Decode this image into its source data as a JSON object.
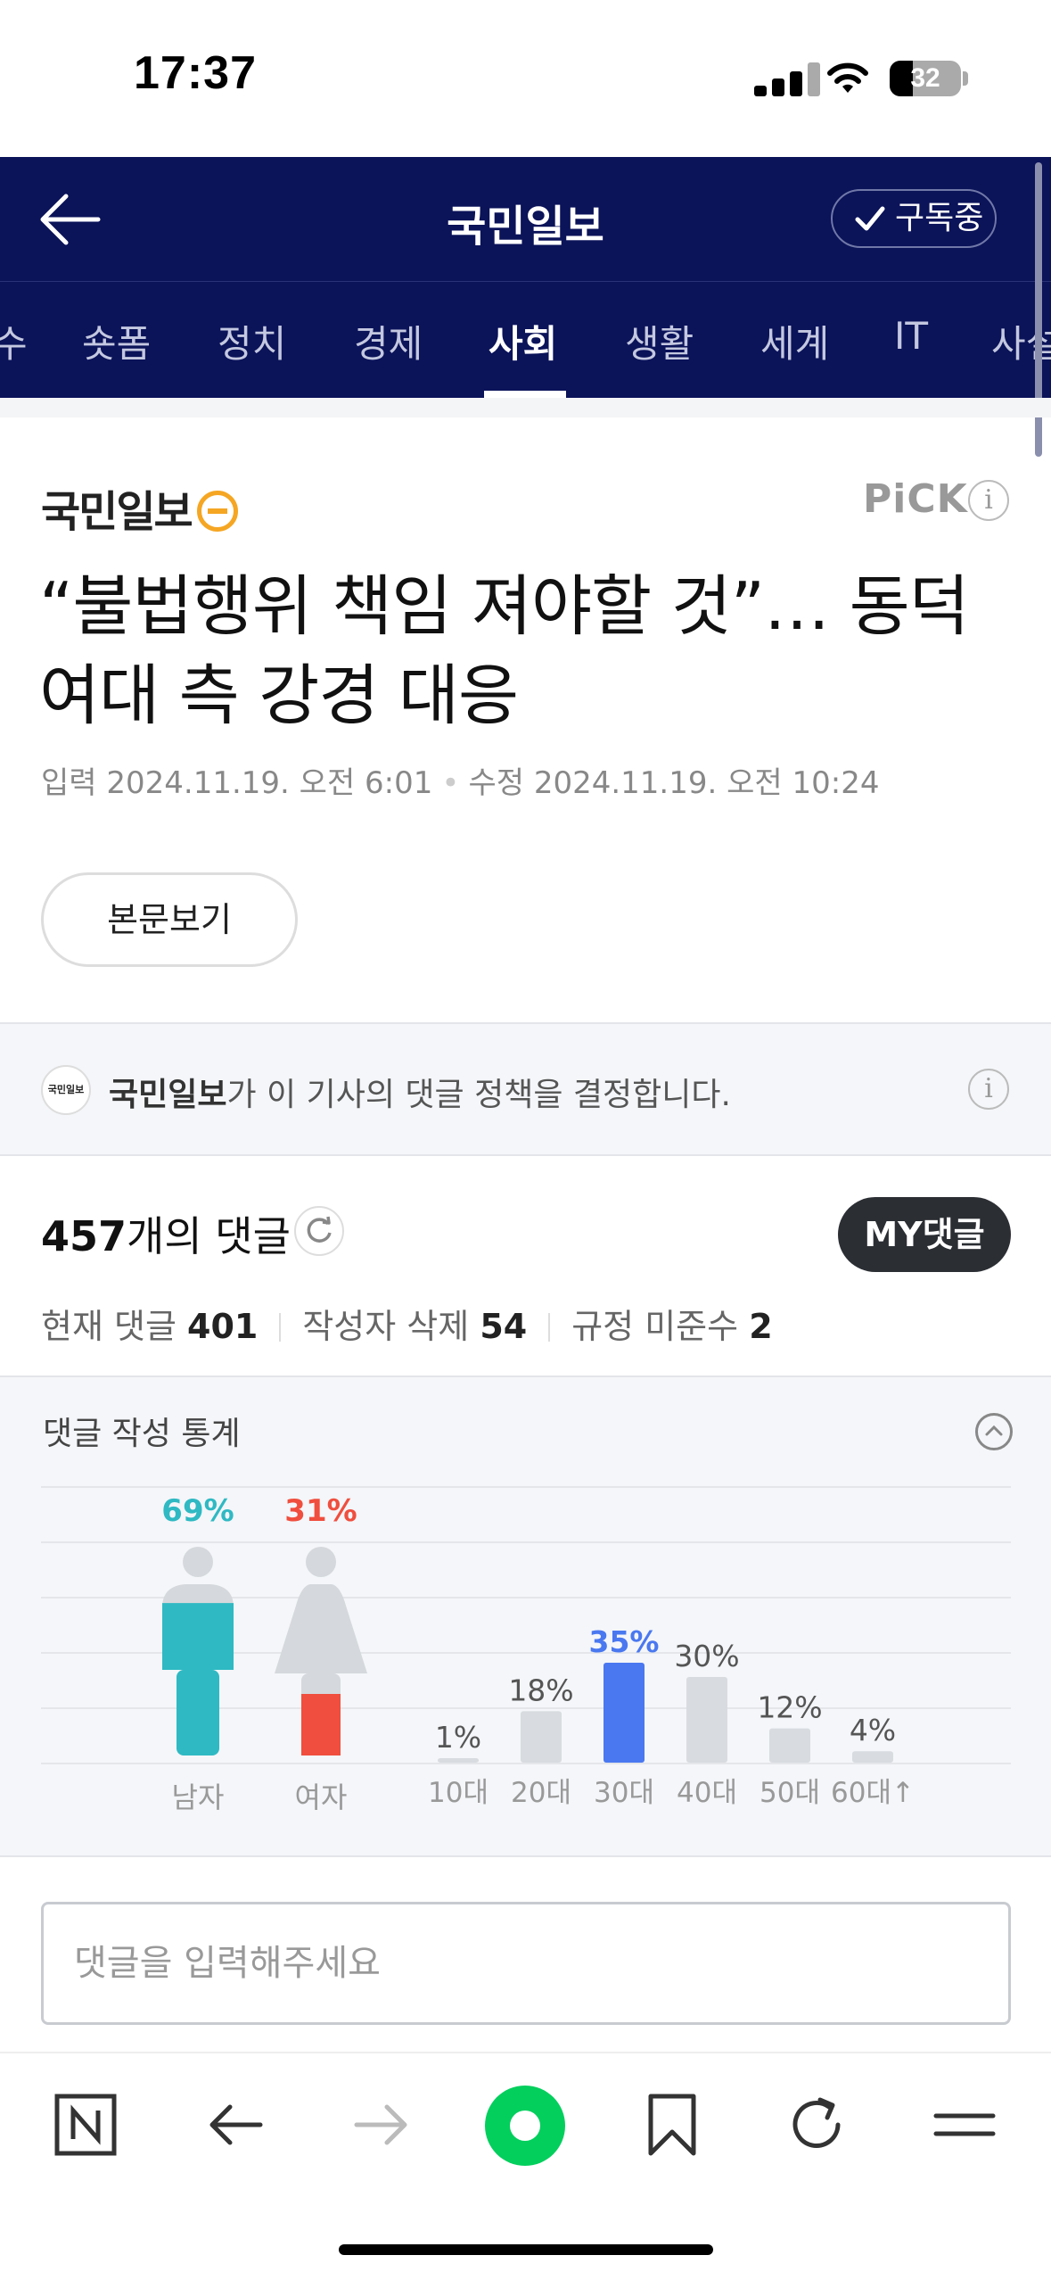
{
  "status_bar": {
    "time": "17:37",
    "battery": "32",
    "battery_level": 0.32
  },
  "header": {
    "back_icon": "arrow-left-icon",
    "title": "국민일보",
    "subscribe_label": "구독중"
  },
  "tabs": [
    {
      "label": "수",
      "active": false
    },
    {
      "label": "숏폼",
      "active": false
    },
    {
      "label": "정치",
      "active": false
    },
    {
      "label": "경제",
      "active": false
    },
    {
      "label": "사회",
      "active": true
    },
    {
      "label": "생활",
      "active": false
    },
    {
      "label": "세계",
      "active": false
    },
    {
      "label": "IT",
      "active": false
    },
    {
      "label": "사설",
      "active": false
    }
  ],
  "article": {
    "press_name": "국민일보",
    "pick_label": "PiCK",
    "headline": "“불법행위 책임 져야할 것”… 동덕여대 측 강경 대응",
    "input_label": "입력",
    "input_date": "2024.11.19. 오전 6:01",
    "modify_label": "수정",
    "modify_date": "2024.11.19. 오전 10:24",
    "view_body_label": "본문보기"
  },
  "policy": {
    "logo_text": "국민일보",
    "press": "국민일보",
    "text": "가 이 기사의 댓글 정책을 결정합니다."
  },
  "comments": {
    "count": "457",
    "count_suffix": "개의 댓글",
    "my_comments_label": "MY댓글",
    "current_label": "현재 댓글",
    "current": "401",
    "author_deleted_label": "작성자 삭제",
    "author_deleted": "54",
    "rule_violation_label": "규정 미준수",
    "rule_violation": "2",
    "input_placeholder": "댓글을 입력해주세요"
  },
  "stats": {
    "title": "댓글 작성 통계",
    "gender": [
      {
        "label": "남자",
        "percent": 69,
        "percent_text": "69%",
        "color": "#2fb9c3"
      },
      {
        "label": "여자",
        "percent": 31,
        "percent_text": "31%",
        "color": "#f04e3e"
      }
    ],
    "chart_data": {
      "type": "bar",
      "categories": [
        "10대",
        "20대",
        "30대",
        "40대",
        "50대",
        "60대↑"
      ],
      "values": [
        1,
        18,
        35,
        30,
        12,
        4
      ],
      "value_labels": [
        "1%",
        "18%",
        "35%",
        "30%",
        "12%",
        "4%"
      ],
      "highlight_index": 2,
      "highlight_color": "#4a78f0",
      "bar_color": "#d8dbdf"
    }
  },
  "toolbar": {
    "icons": [
      "naver-home-icon",
      "back-arrow-icon",
      "forward-arrow-icon",
      "green-dot-icon",
      "bookmark-icon",
      "reload-icon",
      "menu-icon"
    ]
  }
}
